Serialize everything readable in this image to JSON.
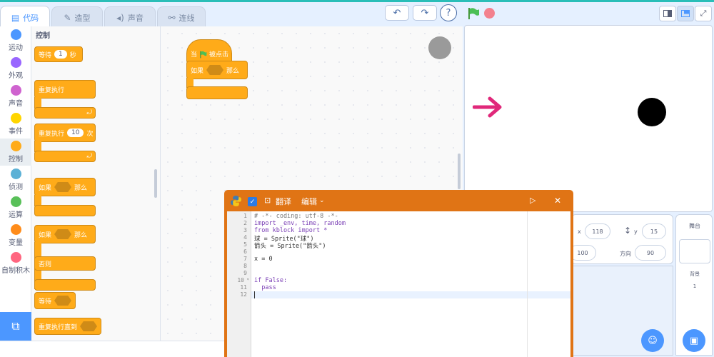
{
  "tabs": [
    {
      "label": "代码",
      "icon": "code-icon"
    },
    {
      "label": "造型",
      "icon": "brush-icon"
    },
    {
      "label": "声音",
      "icon": "speaker-icon"
    },
    {
      "label": "连线",
      "icon": "wire-icon"
    }
  ],
  "toolbar": {
    "help": "?"
  },
  "categories": [
    {
      "label": "运动",
      "color": "#4c97ff"
    },
    {
      "label": "外观",
      "color": "#9966ff"
    },
    {
      "label": "声音",
      "color": "#cf63cf"
    },
    {
      "label": "事件",
      "color": "#ffd500"
    },
    {
      "label": "控制",
      "color": "#ffab19"
    },
    {
      "label": "侦测",
      "color": "#5cb1d6"
    },
    {
      "label": "运算",
      "color": "#59c059"
    },
    {
      "label": "变量",
      "color": "#ff8c1a"
    },
    {
      "label": "自制积木",
      "color": "#ff6680"
    }
  ],
  "palette": {
    "title": "控制",
    "wait_label": "等待",
    "wait_value": "1",
    "wait_unit": "秒",
    "forever_label": "重复执行",
    "repeat_label": "重复执行",
    "repeat_value": "10",
    "repeat_unit": "次",
    "if_label": "如果",
    "then_label": "那么",
    "if2_label": "如果",
    "then2_label": "那么",
    "else_label": "否则",
    "waituntil_label": "等待",
    "repeatuntil_label": "重复执行直到"
  },
  "script": {
    "hat_when": "当",
    "hat_clicked": "被点击",
    "if_label": "如果",
    "then_label": "那么"
  },
  "sprite_info": {
    "x_label": "x",
    "x_value": "118",
    "y_label": "y",
    "y_value": "15",
    "size_value": "100",
    "dir_label": "方向",
    "dir_value": "90"
  },
  "stage_panel": {
    "title": "舞台",
    "backdrop_label": "背景",
    "backdrop_count": "1"
  },
  "python": {
    "translate_label": "翻译",
    "edit_label": "编辑",
    "code_lines": [
      "# -*- coding: utf-8 -*-",
      "import _env, time, random",
      "from kblock import *",
      "球 = Sprite(\"球\")",
      "箭头 = Sprite(\"箭头\")",
      "",
      "x = 0",
      "",
      "",
      "if False:",
      "  pass",
      ""
    ],
    "line_numbers": [
      "1",
      "2",
      "3",
      "4",
      "5",
      "6",
      "7",
      "8",
      "9",
      "10",
      "11",
      "12"
    ]
  },
  "colors": {
    "accent": "#4c97ff",
    "control": "#ffab19",
    "python_window": "#e07415",
    "arrow": "#e0287a"
  }
}
